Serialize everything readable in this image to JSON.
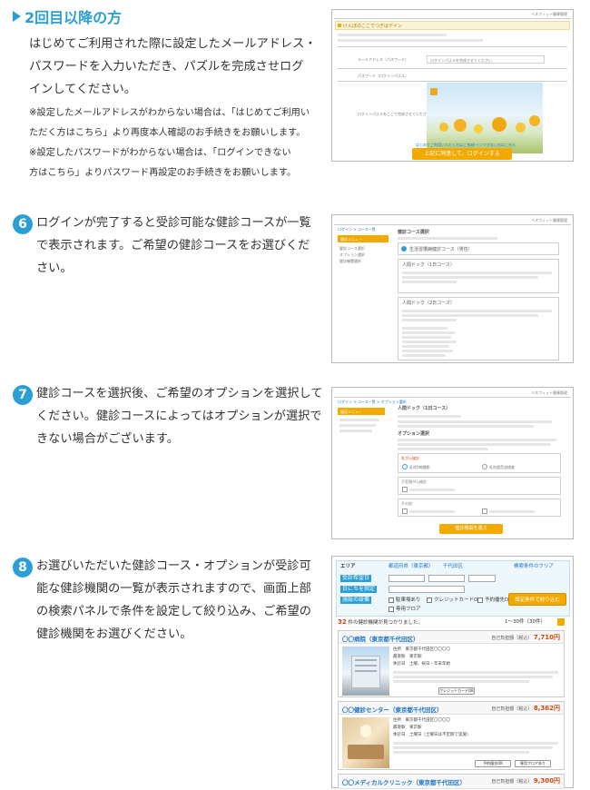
{
  "section": {
    "title": "2回目以降の方"
  },
  "step_login": {
    "lines": [
      "はじめてご利用された際に設定したメールアドレス・",
      "パスワードを入力いただき、パズルを完成させログ",
      "インしてください。"
    ],
    "notes": [
      "※設定したメールアドレスがわからない場合は、「はじめてご利用い",
      "ただく方はこちら」より再度本人確認のお手続きをお願いします。",
      "※設定したパスワードがわからない場合は、「ログインできない",
      "方はこちら」よりパスワード再設定のお手続きをお願いします。"
    ]
  },
  "step6": {
    "number": "6",
    "lines": [
      "ログインが完了すると受診可能な健診コースが一覧",
      "で表示されます。ご希望の健診コースをお選びくだ",
      "さい。"
    ]
  },
  "step7": {
    "number": "7",
    "lines": [
      "健診コースを選択後、ご希望のオプションを選択して",
      "ください。健診コースによってはオプションが選択で",
      "きない場合がございます。"
    ]
  },
  "step8": {
    "number": "8",
    "lines": [
      "お選びいただいた健診コース・オプションが受診可",
      "能な健診機関の一覧が表示されますので、画面上部",
      "の検索パネルで条件を設定して絞り込み、ご希望の",
      "健診機関をお選びください。"
    ]
  },
  "shot_login": {
    "header_right": "ベネフィット健康管理",
    "panel_title": "けんぽのここでつぎはデイン",
    "row1": "メールアドレス（パスワード）",
    "row1_value": "ログインパズルを完成させてください",
    "row2": "パスワード（ログインパズル）",
    "row3": "ログインパズルをここで完成させてください",
    "link1": "はじめてご利用いただく方はこちら",
    "link2": "ログインできない方はこちら",
    "button": "上記に同意して、ログインする"
  },
  "shot_course": {
    "header_right": "ベネフィット健康管理",
    "breadcrumb": "ログイン > コース一覧",
    "side_title": "健診メニュー",
    "side_items": [
      "健診コース選択",
      "オプション選択",
      "健診機関選択"
    ],
    "main_title": "健診コース選択",
    "cards": [
      "生活習慣病健診コース（男性）",
      "人間ドック（1日コース）",
      "人間ドック（2日コース）"
    ]
  },
  "shot_option": {
    "header_right": "ベネフィット健康管理",
    "breadcrumb": "ログイン > コース一覧 > オプション選択",
    "side_title": "健診メニュー",
    "course": "人間ドック（1日コース）",
    "section": "オプション選択",
    "group1": "乳がん検診",
    "opt1": "乳房X線撮影",
    "opt2": "乳房超音波検査",
    "group2": "子宮頸がん検診",
    "group3": "その他",
    "button": "健診機関を選ぶ"
  },
  "shot_search": {
    "area_label": "エリア",
    "area_value": "都道府県（東京都）",
    "city": "千代田区",
    "date_label": "受診希望日",
    "time_label": "日にちを指定",
    "facility_label": "施設の設備",
    "checks": [
      "駐車場あり",
      "クレジットカードOK",
      "予約優先OK",
      "女性スタッフ在籍",
      "専用フロア"
    ],
    "search_button": "設定条件で絞り込む",
    "reset_link": "検索条件のクリア",
    "result_count": "32",
    "result_text": "件の健診機関が見つかりました。",
    "paging": "1〜30件（30件）",
    "facilities": [
      {
        "name": "〇〇病院（東京都千代田区）",
        "price_label": "自己負担額（税込）",
        "price": "7,710円",
        "address": "東京都千代田区〇〇〇〇",
        "access": "東京駅",
        "hours": "土曜、祝日・年末年始",
        "buttons": [
          "クレジットカードOK"
        ]
      },
      {
        "name": "〇〇健診センター（東京都千代田区）",
        "price_label": "自己負担額（税込）",
        "price": "8,362円",
        "address": "東京都千代田区〇〇〇〇",
        "access": "東京駅",
        "hours": "土曜日（土曜日は不定期で実施）",
        "buttons": [
          "予約優先OK",
          "専用フロアあり"
        ]
      },
      {
        "name": "〇〇メディカルクリニック（東京都千代田区）",
        "price_label": "自己負担額（税込）",
        "price": "9,300円"
      }
    ]
  },
  "colors": {
    "accent": "#2a9fd6",
    "button": "#f2a900",
    "price": "#d9480f"
  }
}
